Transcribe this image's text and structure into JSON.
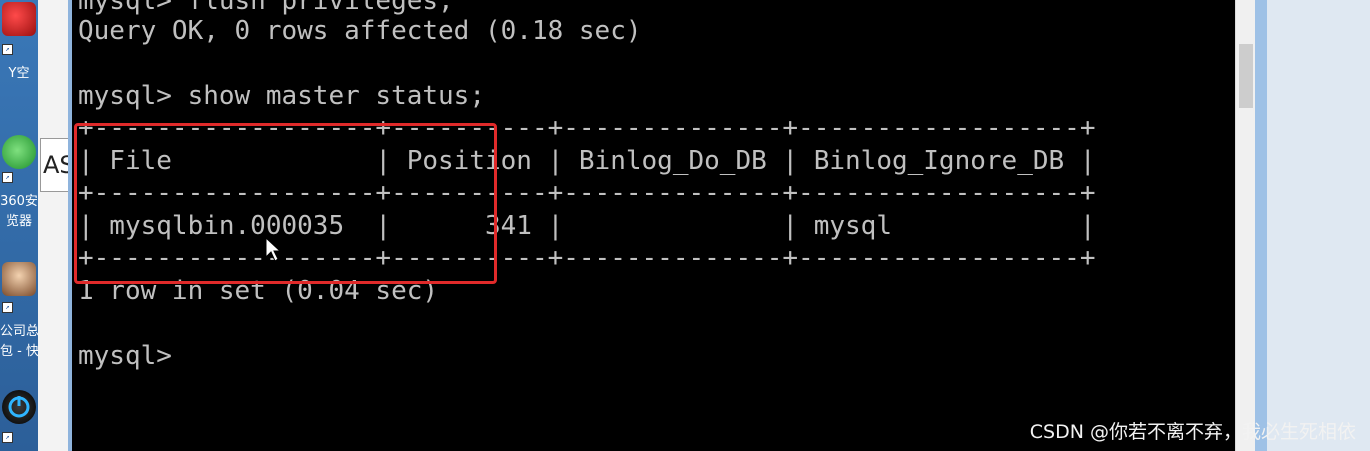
{
  "desktop": {
    "labels": [
      "Y空",
      "360安",
      "览器",
      "公司总",
      "包 - 快"
    ]
  },
  "window_peek_text": "AS",
  "terminal": {
    "lines": [
      "mysql> flush privileges;",
      "Query OK, 0 rows affected (0.18 sec)",
      "",
      "mysql> show master status;"
    ],
    "table": {
      "border": "+------------------+----------+--------------+------------------+",
      "header": "| File             | Position | Binlog_Do_DB | Binlog_Ignore_DB |",
      "row": "| mysqlbin.000035  |      341 |              | mysql            |"
    },
    "footer": "1 row in set (0.04 sec)",
    "prompt": "mysql>"
  },
  "watermark": "CSDN @你若不离不弃，我必生死相依",
  "colors": {
    "terminal_bg": "#000000",
    "terminal_text": "#c0c0c0",
    "highlight": "#e02a2a"
  }
}
